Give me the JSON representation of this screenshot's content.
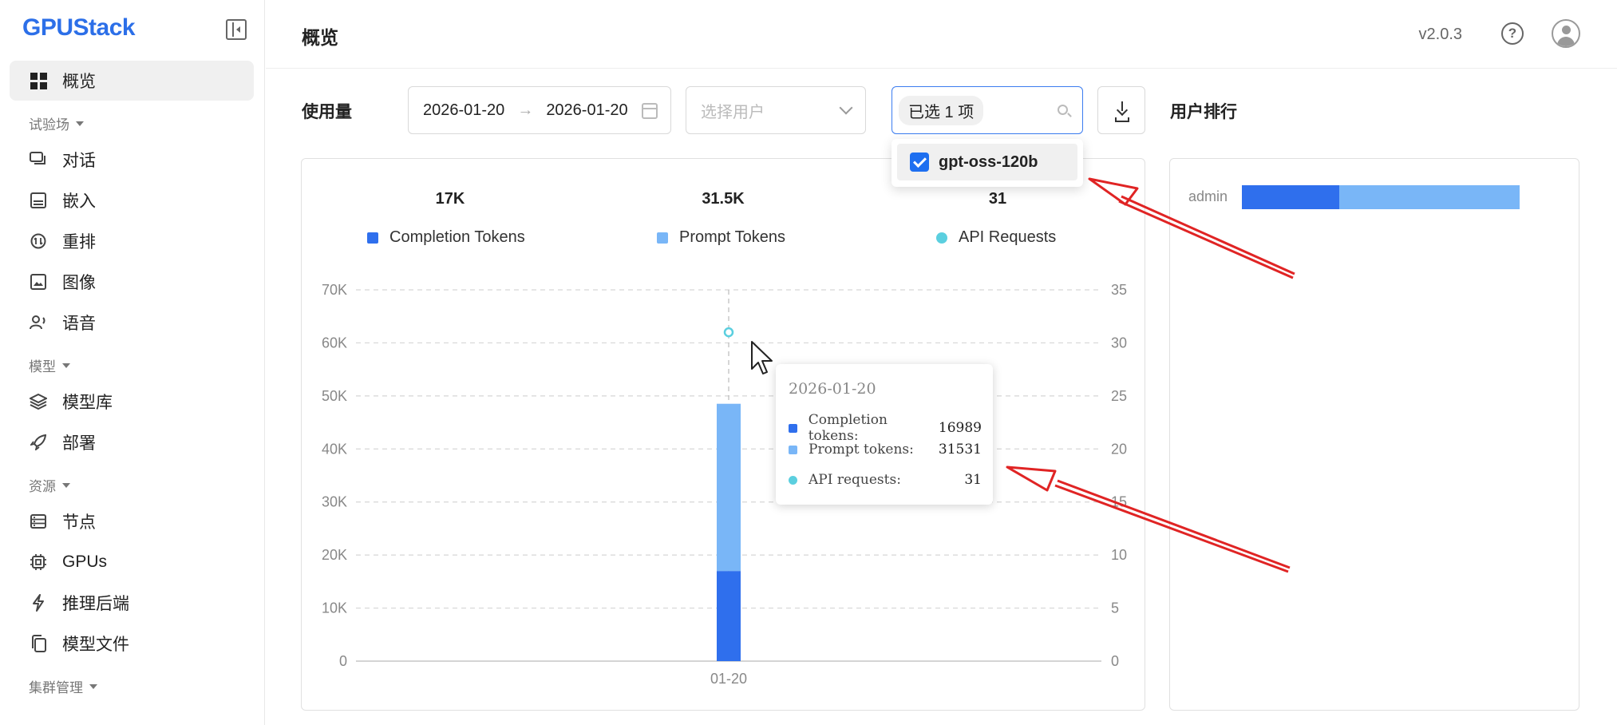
{
  "app": {
    "logo": "GPUStack",
    "version": "v2.0.3"
  },
  "sidebar": {
    "items": [
      {
        "key": "overview",
        "label": "概览",
        "active": true
      },
      {
        "key": "group-playground",
        "label": "试验场",
        "group": true
      },
      {
        "key": "chat",
        "label": "对话"
      },
      {
        "key": "embed",
        "label": "嵌入"
      },
      {
        "key": "rerank",
        "label": "重排"
      },
      {
        "key": "image",
        "label": "图像"
      },
      {
        "key": "audio",
        "label": "语音"
      },
      {
        "key": "group-models",
        "label": "模型",
        "group": true
      },
      {
        "key": "model-library",
        "label": "模型库"
      },
      {
        "key": "deploy",
        "label": "部署"
      },
      {
        "key": "group-resources",
        "label": "资源",
        "group": true
      },
      {
        "key": "nodes",
        "label": "节点"
      },
      {
        "key": "gpus",
        "label": "GPUs"
      },
      {
        "key": "backends",
        "label": "推理后端"
      },
      {
        "key": "model-files",
        "label": "模型文件"
      },
      {
        "key": "group-cluster",
        "label": "集群管理",
        "group": true
      }
    ]
  },
  "header": {
    "title": "概览"
  },
  "usage": {
    "title": "使用量",
    "date_start": "2026-01-20",
    "date_arrow": "→",
    "date_end": "2026-01-20",
    "user_placeholder": "选择用户",
    "model_selected_tag": "已选 1 项",
    "dropdown_option": "gpt-oss-120b",
    "stats": {
      "completion": "17K",
      "prompt": "31.5K",
      "requests": "31"
    },
    "legend": {
      "completion": "Completion Tokens",
      "prompt": "Prompt Tokens",
      "requests": "API Requests"
    }
  },
  "tooltip": {
    "date": "2026-01-20",
    "rows": [
      {
        "label": "Completion tokens:",
        "value": "16989"
      },
      {
        "label": "Prompt tokens:",
        "value": "31531"
      },
      {
        "label": "API requests:",
        "value": "31"
      }
    ]
  },
  "ranking": {
    "title": "用户排行",
    "users": [
      {
        "name": "admin",
        "completion_tokens": 16989,
        "prompt_tokens": 31531
      }
    ]
  },
  "colors": {
    "completion": "#2f6fed",
    "prompt": "#79b6f7",
    "requests": "#5bcfdf",
    "annotation": "#e02424"
  },
  "chart_data": {
    "type": "bar",
    "categories": [
      "01-20"
    ],
    "series": [
      {
        "name": "Completion Tokens",
        "values": [
          16989
        ],
        "stack": "tokens"
      },
      {
        "name": "Prompt Tokens",
        "values": [
          31531
        ],
        "stack": "tokens"
      },
      {
        "name": "API Requests",
        "values": [
          31
        ],
        "type": "scatter",
        "axis": "right"
      }
    ],
    "y_left": {
      "ticks": [
        "0",
        "10K",
        "20K",
        "30K",
        "40K",
        "50K",
        "60K",
        "70K"
      ],
      "ylim": [
        0,
        70000
      ]
    },
    "y_right": {
      "ticks": [
        "0",
        "5",
        "10",
        "15",
        "20",
        "25",
        "30",
        "35"
      ],
      "ylim": [
        0,
        35
      ]
    },
    "grid": true,
    "legend": "top"
  }
}
